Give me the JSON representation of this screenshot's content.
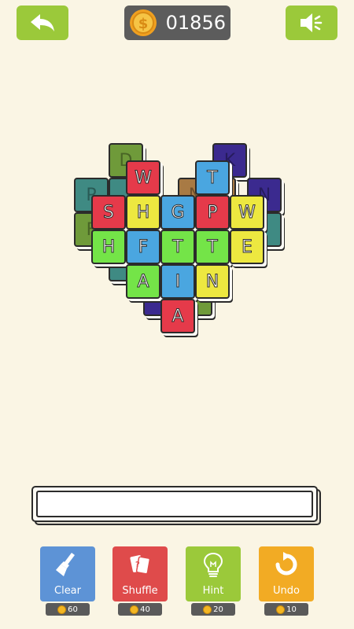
{
  "header": {
    "back_icon": "back-arrow-icon",
    "sound_icon": "speaker-icon",
    "coins": "01856"
  },
  "board": {
    "tiles": [
      {
        "id": "b1",
        "letter": "D",
        "color": "#6f9a3a",
        "back": true
      },
      {
        "id": "b2",
        "letter": "K",
        "color": "#3b2a8f",
        "back": true
      },
      {
        "id": "b3",
        "letter": "P",
        "color": "#3f8a83",
        "back": true
      },
      {
        "id": "b4",
        "letter": "N",
        "color": "#3b2a8f",
        "back": true
      },
      {
        "id": "b5",
        "letter": "F",
        "color": "#6f9a3a",
        "back": true
      },
      {
        "id": "b6",
        "letter": "",
        "color": "#3f8a83",
        "back": true
      },
      {
        "id": "b7",
        "letter": "N",
        "color": "#a87a44",
        "back": true
      },
      {
        "id": "b8",
        "letter": "",
        "color": "#a87a44",
        "back": true
      },
      {
        "id": "b9",
        "letter": "",
        "color": "#3f8a83",
        "back": true
      },
      {
        "id": "b10",
        "letter": "",
        "color": "#3f8a83",
        "back": true
      },
      {
        "id": "b11",
        "letter": "",
        "color": "#3b2a8f",
        "back": true
      },
      {
        "id": "b12",
        "letter": "",
        "color": "#6f9a3a",
        "back": true
      },
      {
        "id": "t1",
        "letter": "W",
        "color": "#e53a4a"
      },
      {
        "id": "t2",
        "letter": "T",
        "color": "#4aa6e0"
      },
      {
        "id": "t3",
        "letter": "S",
        "color": "#e53a4a"
      },
      {
        "id": "t4",
        "letter": "H",
        "color": "#ede840"
      },
      {
        "id": "t5",
        "letter": "G",
        "color": "#4aa6e0"
      },
      {
        "id": "t6",
        "letter": "P",
        "color": "#e53a4a"
      },
      {
        "id": "t7",
        "letter": "W",
        "color": "#ede840"
      },
      {
        "id": "t8",
        "letter": "H",
        "color": "#74e448"
      },
      {
        "id": "t9",
        "letter": "F",
        "color": "#4aa6e0"
      },
      {
        "id": "t10",
        "letter": "T",
        "color": "#74e448"
      },
      {
        "id": "t11",
        "letter": "T",
        "color": "#74e448"
      },
      {
        "id": "t12",
        "letter": "E",
        "color": "#ede840"
      },
      {
        "id": "t13",
        "letter": "A",
        "color": "#74e448"
      },
      {
        "id": "t14",
        "letter": "I",
        "color": "#4aa6e0"
      },
      {
        "id": "t15",
        "letter": "N",
        "color": "#ede840"
      },
      {
        "id": "t16",
        "letter": "A",
        "color": "#e53a4a"
      }
    ]
  },
  "word_slot": {
    "value": ""
  },
  "tools": [
    {
      "id": "clear",
      "label": "Clear",
      "cost": "60",
      "color": "#5d93d6",
      "icon": "broom-icon"
    },
    {
      "id": "shuffle",
      "label": "Shuffle",
      "cost": "40",
      "color": "#df4b4b",
      "icon": "cards-icon"
    },
    {
      "id": "hint",
      "label": "Hint",
      "cost": "20",
      "color": "#9bc93a",
      "icon": "lightbulb-icon"
    },
    {
      "id": "undo",
      "label": "Undo",
      "cost": "10",
      "color": "#f2ab24",
      "icon": "undo-arrow-icon"
    }
  ]
}
